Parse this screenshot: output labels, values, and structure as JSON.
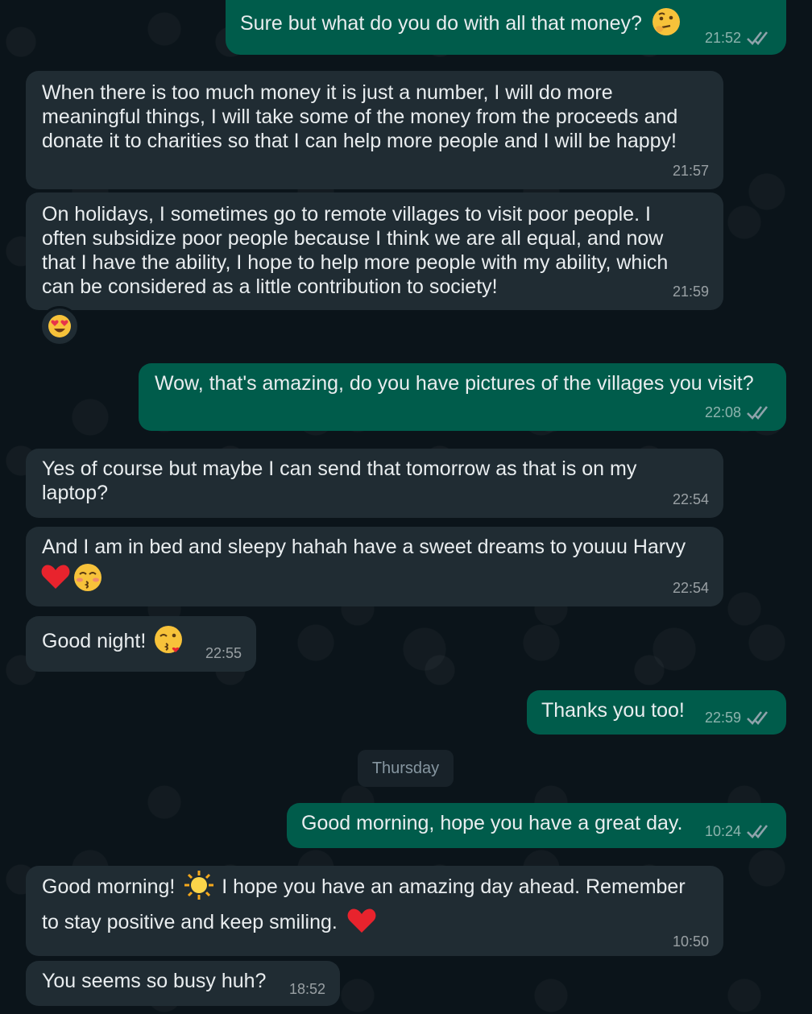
{
  "messages": [
    {
      "text": "Sure but what do you do with all that money?",
      "time": "21:52",
      "emoji": "thinking-face-icon"
    },
    {
      "text": "When there is too much money it is just a number, I will do more meaningful things, I will take some of the money from the proceeds and donate it to charities so that I can help more people and I will be happy!",
      "time": "21:57"
    },
    {
      "text": "On holidays, I sometimes go to remote villages to visit poor people. I often subsidize poor people because I think we are all equal, and now that I have the ability, I hope to help more people with my ability, which can be considered as a little contribution to society!",
      "time": "21:59",
      "reaction": "heart-eyes-icon"
    },
    {
      "text": "Wow, that's amazing, do you have pictures of the villages you visit?",
      "time": "22:08"
    },
    {
      "text": "Yes of course but maybe I can send that tomorrow as that is on my laptop?",
      "time": "22:54"
    },
    {
      "text": "And I am in bed and sleepy hahah have a sweet dreams to youuu Harvy",
      "time": "22:54",
      "emoji": "heart-and-kissing-face-icons"
    },
    {
      "text": "Good night!",
      "time": "22:55",
      "emoji": "kissing-heart-icon"
    },
    {
      "text": "Thanks you too!",
      "time": "22:59"
    },
    {
      "text": "Good morning, hope you have a great day.",
      "time": "10:24"
    },
    {
      "text_before": "Good morning!",
      "text": "I hope you have an amazing day ahead. Remember to stay positive and keep smiling.",
      "time": "10:50",
      "emoji": "sun-and-heart-icons"
    },
    {
      "text": "You seems so busy huh?",
      "time": "18:52"
    }
  ],
  "day_separator": "Thursday",
  "colors": {
    "background": "#0b141a",
    "incoming_bubble": "#202c33",
    "outgoing_bubble": "#005c4b",
    "read_ticks": "#8696a0"
  }
}
